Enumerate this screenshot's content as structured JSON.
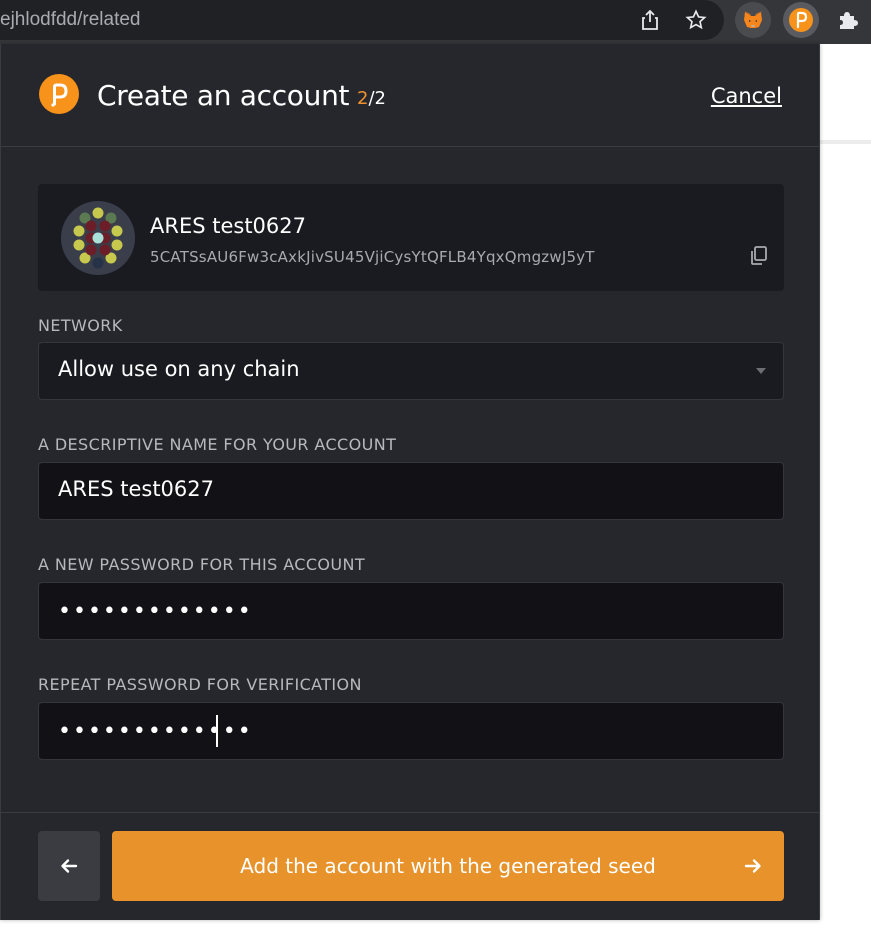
{
  "browser": {
    "url_fragment": "ejhlodfdd/related",
    "icons": [
      "share-icon",
      "star-icon",
      "metamask-fox-icon",
      "polkadot-extension-icon",
      "puzzle-extensions-icon"
    ]
  },
  "header": {
    "title": "Create an account",
    "step_current": "2",
    "step_total": "/2",
    "cancel_label": "Cancel"
  },
  "account": {
    "name": "ARES test0627",
    "address": "5CATSsAU6Fw3cAxkJivSU45VjiCysYtQFLB4YqxQmgzwJ5yT"
  },
  "form": {
    "network": {
      "label": "NETWORK",
      "value": "Allow use on any chain"
    },
    "name": {
      "label": "A DESCRIPTIVE NAME FOR YOUR ACCOUNT",
      "value": "ARES test0627"
    },
    "password": {
      "label": "A NEW PASSWORD FOR THIS ACCOUNT",
      "value": "•••••••••••••"
    },
    "repeat_password": {
      "label": "REPEAT PASSWORD FOR VERIFICATION",
      "value": "•••••••••••••"
    }
  },
  "footer": {
    "back_icon": "arrow-left-icon",
    "primary_label": "Add the account with the generated seed",
    "primary_icon": "arrow-right-icon"
  },
  "colors": {
    "accent": "#e7922b",
    "popup_background": "#26272c",
    "field_background": "#111116"
  }
}
